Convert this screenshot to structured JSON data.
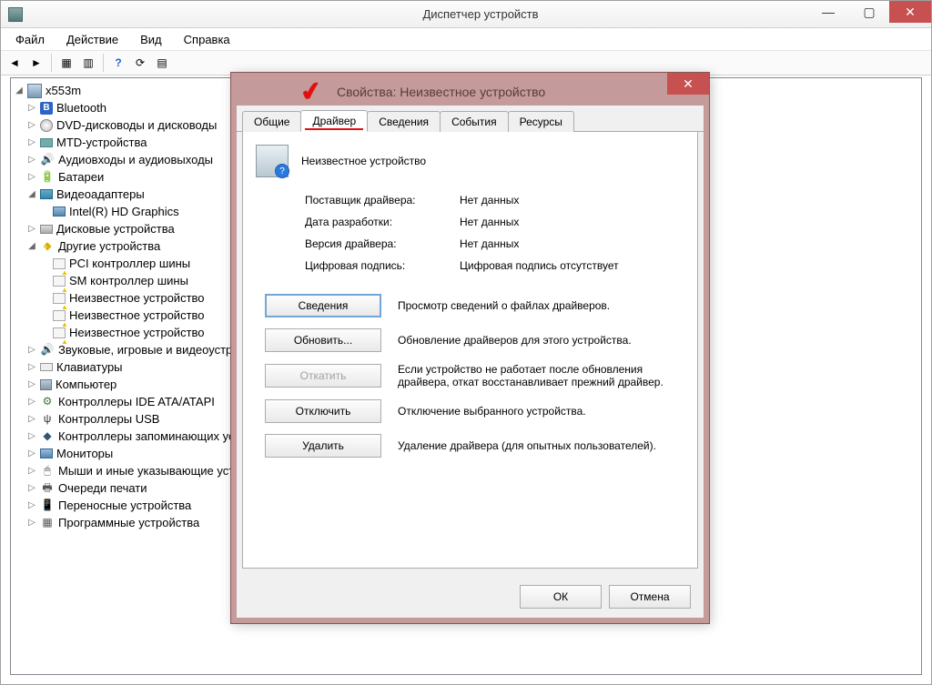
{
  "window": {
    "title": "Диспетчер устройств"
  },
  "menu": {
    "file": "Файл",
    "action": "Действие",
    "view": "Вид",
    "help": "Справка"
  },
  "tree": {
    "root": "x553m",
    "nodes": {
      "bluetooth": "Bluetooth",
      "dvd": "DVD-дисководы и дисководы",
      "mtd": "MTD-устройства",
      "audio": "Аудиовходы и аудиовыходы",
      "battery": "Батареи",
      "video": "Видеоадаптеры",
      "intel": "Intel(R) HD Graphics",
      "disk": "Дисковые устройства",
      "other": "Другие устройства",
      "pci": "PCI контроллер шины",
      "sm": "SM контроллер шины",
      "unknown1": "Неизвестное устройство",
      "unknown2": "Неизвестное устройство",
      "unknown3": "Неизвестное устройство",
      "sound": "Звуковые, игровые и видеоустройства",
      "keyboard": "Клавиатуры",
      "computer": "Компьютер",
      "ide": "Контроллеры IDE ATA/ATAPI",
      "usb": "Контроллеры USB",
      "storage": "Контроллеры запоминающих устройств",
      "monitor": "Мониторы",
      "mouse": "Мыши и иные указывающие устройства",
      "printer": "Очереди печати",
      "portable": "Переносные устройства",
      "software": "Программные устройства"
    }
  },
  "dialog": {
    "title": "Свойства: Неизвестное устройство",
    "tabs": {
      "general": "Общие",
      "driver": "Драйвер",
      "details": "Сведения",
      "events": "События",
      "resources": "Ресурсы"
    },
    "device_name": "Неизвестное устройство",
    "rows": {
      "provider_label": "Поставщик драйвера:",
      "provider_value": "Нет данных",
      "date_label": "Дата разработки:",
      "date_value": "Нет данных",
      "version_label": "Версия драйвера:",
      "version_value": "Нет данных",
      "signature_label": "Цифровая подпись:",
      "signature_value": "Цифровая подпись отсутствует"
    },
    "actions": {
      "details": {
        "btn": "Сведения",
        "desc": "Просмотр сведений о файлах драйверов."
      },
      "update": {
        "btn": "Обновить...",
        "desc": "Обновление драйверов для этого устройства."
      },
      "rollback": {
        "btn": "Откатить",
        "desc": "Если устройство не работает после обновления драйвера, откат восстанавливает прежний драйвер."
      },
      "disable": {
        "btn": "Отключить",
        "desc": "Отключение выбранного устройства."
      },
      "uninstall": {
        "btn": "Удалить",
        "desc": "Удаление драйвера (для опытных пользователей)."
      }
    },
    "ok": "ОК",
    "cancel": "Отмена"
  }
}
